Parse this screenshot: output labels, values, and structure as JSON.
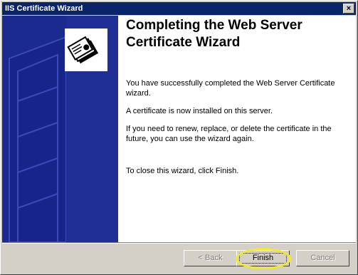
{
  "window": {
    "title": "IIS Certificate Wizard"
  },
  "heading": "Completing the Web Server Certificate Wizard",
  "paragraphs": [
    "You have successfully completed the Web Server Certificate wizard.",
    "A certificate is now installed on this server.",
    "If you need to renew, replace, or delete the certificate in the future, you can use the wizard again.",
    "To close this wizard, click Finish."
  ],
  "buttons": {
    "back": "< Back",
    "finish": "Finish",
    "cancel": "Cancel"
  },
  "colors": {
    "titlebar": "#0a246a",
    "sidebar": "#1b2a8e",
    "highlight": "#f2ea2a"
  },
  "icons": {
    "wizard": "certificate-icon",
    "close": "close-icon"
  }
}
